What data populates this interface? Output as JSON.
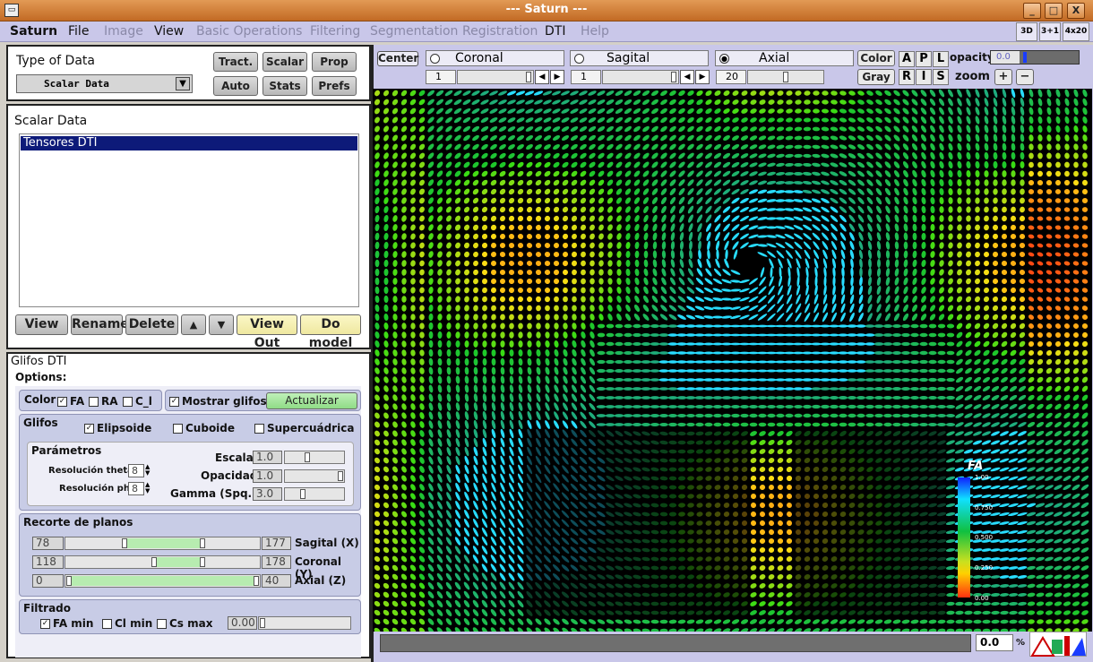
{
  "window": {
    "title": "--- Saturn ---",
    "buttons": [
      "_",
      "□",
      "X"
    ]
  },
  "menubar": {
    "items": [
      "Saturn",
      "File",
      "Image",
      "View",
      "Basic Operations",
      "Filtering",
      "Segmentation",
      "Registration",
      "DTI",
      "Help"
    ],
    "view_modes": [
      "3D",
      "3+1",
      "4x20"
    ]
  },
  "type_of_data": {
    "title": "Type of Data",
    "selected": "Scalar Data",
    "buttons": [
      "Tract.",
      "Scalar",
      "Prop",
      "Auto",
      "Stats",
      "Prefs"
    ]
  },
  "scalar_data": {
    "title": "Scalar Data",
    "items": [
      "Tensores DTI"
    ],
    "buttons": [
      "View",
      "Rename",
      "Delete",
      "▲",
      "▼",
      "View Out",
      "Do model"
    ]
  },
  "glifos": {
    "title": "Glifos DTI",
    "options_label": "Options:",
    "color_label": "Color",
    "color_opts": [
      {
        "label": "FA",
        "checked": true
      },
      {
        "label": "RA",
        "checked": false
      },
      {
        "label": "C_l",
        "checked": false
      }
    ],
    "mostrar": {
      "label": "Mostrar glifos",
      "checked": true
    },
    "actualizar": "Actualizar",
    "glifos_label": "Glifos",
    "shapes": [
      {
        "label": "Elipsoide",
        "checked": true
      },
      {
        "label": "Cuboide",
        "checked": false
      },
      {
        "label": "Supercuádrica",
        "checked": false
      }
    ],
    "parametros": "Parámetros",
    "res_theta_label": "Resolución theta",
    "res_theta": "8",
    "res_phi_label": "Resolución phi",
    "res_phi": "8",
    "escala_label": "Escala",
    "escala": "1.0",
    "opacidad_label": "Opacidad",
    "opacidad": "1.0",
    "gamma_label": "Gamma (Spq.)",
    "gamma": "3.0"
  },
  "recorte": {
    "title": "Recorte de planos",
    "rows": [
      {
        "min": "78",
        "max": "177",
        "label": "Sagital (X)"
      },
      {
        "min": "118",
        "max": "178",
        "label": "Coronal (Y)"
      },
      {
        "min": "0",
        "max": "40",
        "label": "Axial (Z)"
      }
    ]
  },
  "filtrado": {
    "title": "Filtrado",
    "opts": [
      {
        "label": "FA min",
        "checked": true
      },
      {
        "label": "Cl min",
        "checked": false
      },
      {
        "label": "Cs max",
        "checked": false
      }
    ],
    "value": "0.00"
  },
  "viewer": {
    "center": "Center",
    "planes": [
      {
        "label": "Coronal",
        "selected": false,
        "value": "1"
      },
      {
        "label": "Sagital",
        "selected": false,
        "value": "1"
      },
      {
        "label": "Axial",
        "selected": true,
        "value": "20"
      }
    ],
    "color_btn": "Color",
    "gray_btn": "Gray",
    "letters_top": [
      "A",
      "P",
      "L"
    ],
    "letters_bottom": [
      "R",
      "I",
      "S"
    ],
    "opacity_label": "opacity",
    "opacity_value": "0.0",
    "zoom_label": "zoom",
    "zoom_in": "+",
    "zoom_out": "−",
    "colorbar": {
      "title": "FA",
      "ticks": [
        "1.00",
        "0.750",
        "0.500",
        "0.250",
        "0.00"
      ]
    },
    "status_value": "0.0",
    "status_unit": "%",
    "logo": "LPI"
  }
}
